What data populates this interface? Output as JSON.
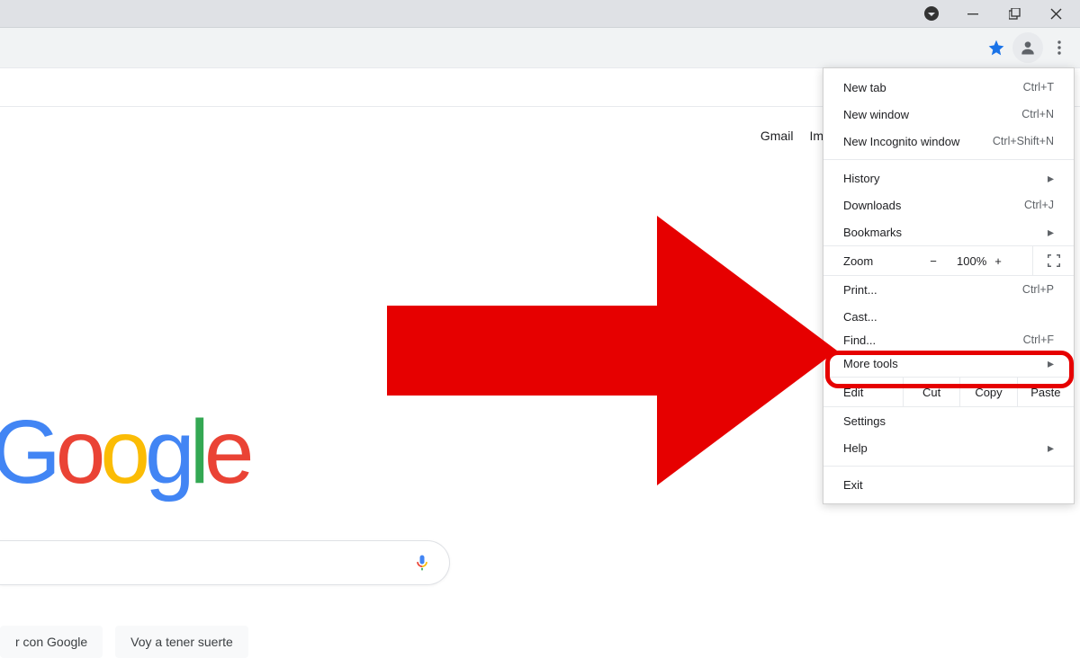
{
  "window": {
    "security_dropdown": "▾"
  },
  "toolbar": {
    "bookmark_color": "#1a73e8"
  },
  "toplinks": {
    "gmail": "Gmail",
    "images": "Im"
  },
  "logo": {
    "g1": "G",
    "o1": "o",
    "o2": "o",
    "g2": "g",
    "l": "l",
    "e": "e"
  },
  "search_buttons": {
    "search": "r con Google",
    "lucky": "Voy a tener suerte"
  },
  "menu": {
    "new_tab": {
      "label": "New tab",
      "shortcut": "Ctrl+T"
    },
    "new_window": {
      "label": "New window",
      "shortcut": "Ctrl+N"
    },
    "incognito": {
      "label": "New Incognito window",
      "shortcut": "Ctrl+Shift+N"
    },
    "history": {
      "label": "History",
      "submenu": "▸"
    },
    "downloads": {
      "label": "Downloads",
      "shortcut": "Ctrl+J"
    },
    "bookmarks": {
      "label": "Bookmarks",
      "submenu": "▸"
    },
    "zoom": {
      "label": "Zoom",
      "minus": "−",
      "value": "100%",
      "plus": "+"
    },
    "print": {
      "label": "Print...",
      "shortcut": "Ctrl+P"
    },
    "cast": {
      "label": "Cast..."
    },
    "find": {
      "label": "Find...",
      "shortcut": "Ctrl+F"
    },
    "more_tools": {
      "label": "More tools",
      "submenu": "▸"
    },
    "edit": {
      "label": "Edit",
      "cut": "Cut",
      "copy": "Copy",
      "paste": "Paste"
    },
    "settings": {
      "label": "Settings"
    },
    "help": {
      "label": "Help",
      "submenu": "▸"
    },
    "exit": {
      "label": "Exit"
    }
  }
}
